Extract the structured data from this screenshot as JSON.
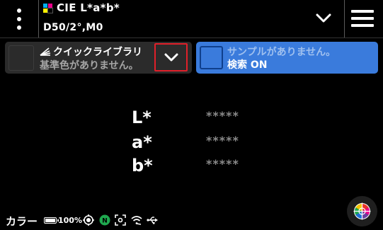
{
  "header": {
    "mode_title": "CIE L*a*b*",
    "mode_subtitle": "D50/2°,M0",
    "cmyk_colors": [
      "#00aeef",
      "#ec008c",
      "#fff200",
      "#000000"
    ]
  },
  "library": {
    "title": "クイックライブラリ",
    "subtitle": "基準色がありません。",
    "toggle_highlight_color": "#e0202a"
  },
  "sample": {
    "title": "サンプルがありません。",
    "subtitle": "検索 ON",
    "panel_color": "#3a7bdc"
  },
  "measurements": [
    {
      "label": "L*",
      "value": "*****"
    },
    {
      "label": "a*",
      "value": "*****"
    },
    {
      "label": "b*",
      "value": "*****"
    }
  ],
  "status": {
    "label": "カラー",
    "battery": "100%",
    "icons": [
      "target-icon",
      "n-badge-icon",
      "focus-icon",
      "wifi-icon",
      "usb-icon"
    ]
  },
  "icons": {
    "menu": "kebab-menu-icon",
    "mode_dropdown": "chevron-down-icon",
    "hamburger": "hamburger-menu-icon",
    "library": "library-stack-icon",
    "color_wheel": "color-wheel-icon"
  }
}
